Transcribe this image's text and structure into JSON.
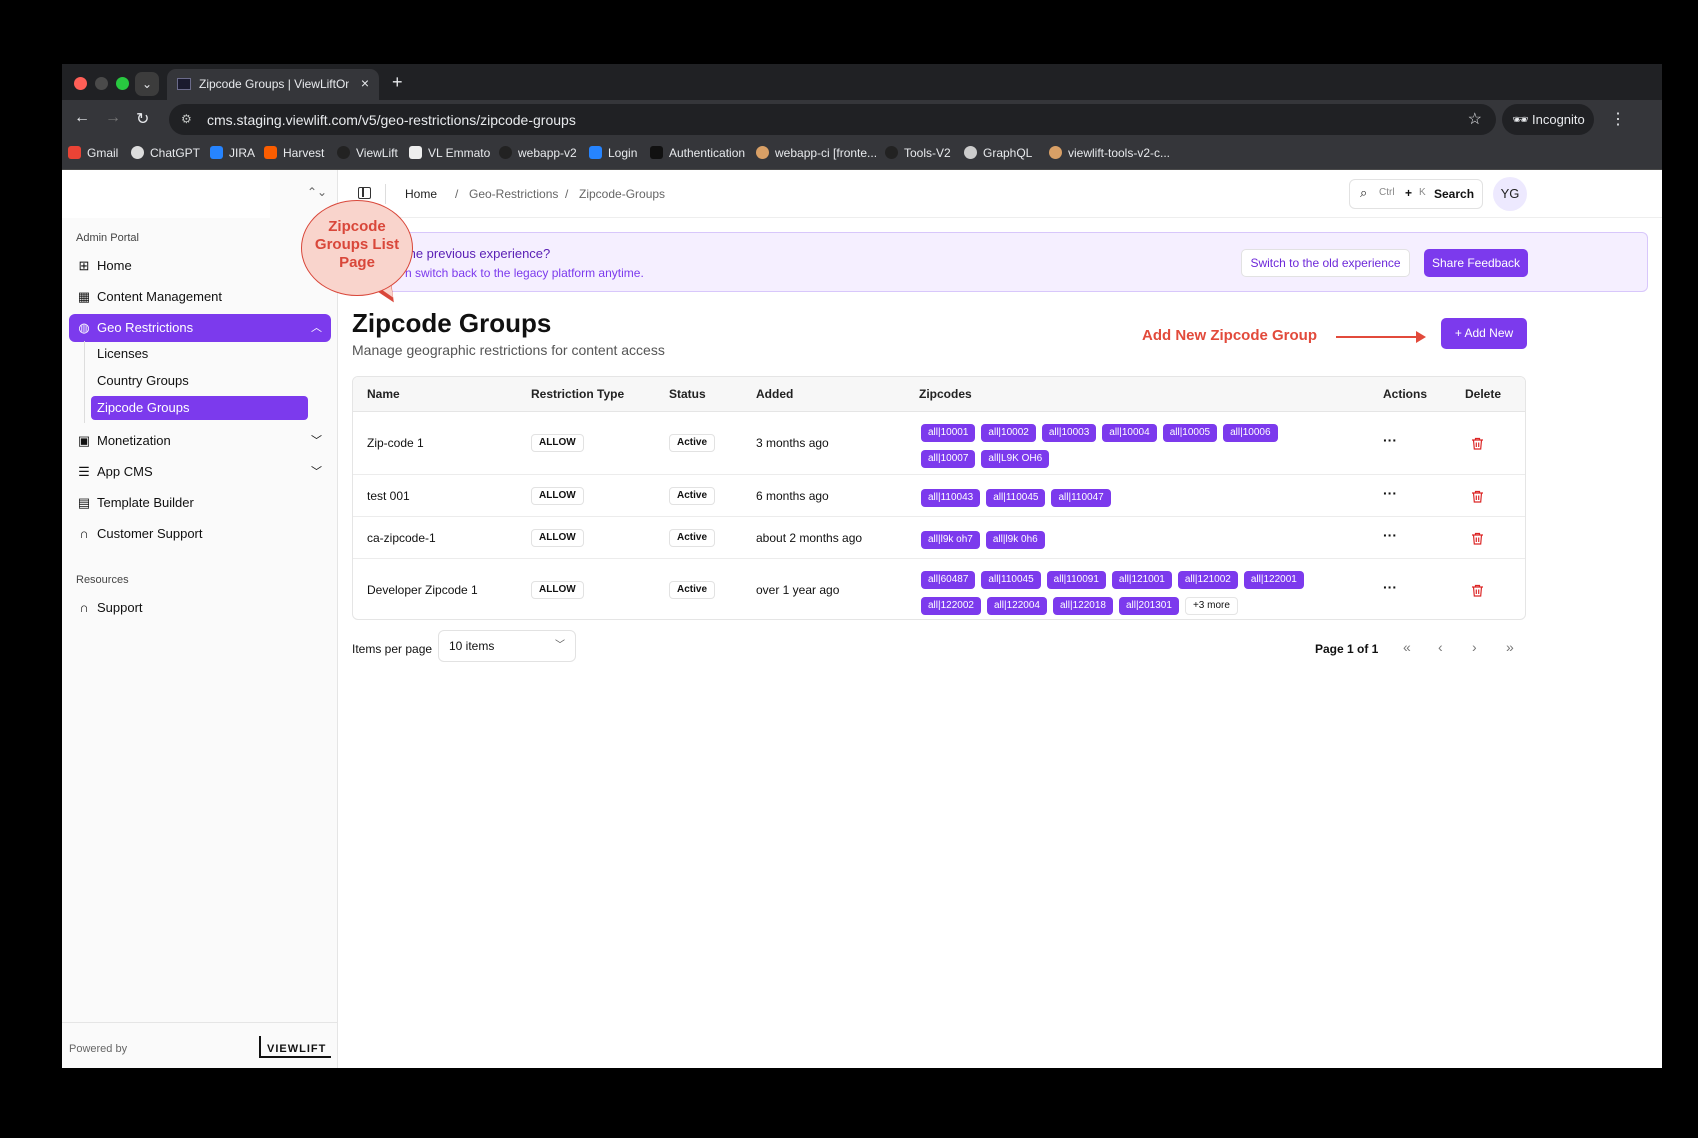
{
  "browser": {
    "tab_title": "Zipcode Groups | ViewLiftOne",
    "url": "cms.staging.viewlift.com/v5/geo-restrictions/zipcode-groups",
    "profile": "Incognito",
    "bookmarks": [
      "Gmail",
      "ChatGPT",
      "JIRA",
      "Harvest",
      "ViewLift",
      "VL Emmato",
      "webapp-v2",
      "Login",
      "Authentication",
      "webapp-ci [fronte...",
      "Tools-V2",
      "GraphQL",
      "viewlift-tools-v2-c..."
    ]
  },
  "sidebar": {
    "section_admin": "Admin Portal",
    "items": [
      {
        "label": "Home",
        "icon": "grid-icon"
      },
      {
        "label": "Content Management",
        "icon": "film-icon"
      },
      {
        "label": "Geo Restrictions",
        "icon": "globe-icon",
        "active": true
      },
      {
        "label": "Monetization",
        "icon": "wallet-icon"
      },
      {
        "label": "App CMS",
        "icon": "sliders-icon"
      },
      {
        "label": "Template Builder",
        "icon": "layout-icon"
      },
      {
        "label": "Customer Support",
        "icon": "headset-icon"
      }
    ],
    "subitems": [
      "Licenses",
      "Country Groups",
      "Zipcode Groups"
    ],
    "section_resources": "Resources",
    "support": "Support",
    "powered_by": "Powered by",
    "logo_text": "VIEWLIFT"
  },
  "topbar": {
    "breadcrumb": [
      "Home",
      "Geo-Restrictions",
      "Zipcode-Groups"
    ],
    "search_kbd_1": "Ctrl",
    "search_plus": "+",
    "search_kbd_2": "K",
    "search_label": "Search",
    "avatar": "YG"
  },
  "banner": {
    "title": "the previous experience?",
    "subtitle": "n switch back to the legacy platform anytime.",
    "switch_button": "Switch to the old experience",
    "feedback_button": "Share Feedback"
  },
  "annotations": {
    "callout": "Zipcode Groups List Page",
    "add_new_label": "Add New Zipcode Group"
  },
  "page": {
    "title": "Zipcode Groups",
    "subtitle": "Manage geographic restrictions for content access",
    "add_button": "+ Add New"
  },
  "table": {
    "headers": [
      "Name",
      "Restriction Type",
      "Status",
      "Added",
      "Zipcodes",
      "Actions",
      "Delete"
    ],
    "rows": [
      {
        "name": "Zip-code 1",
        "type": "ALLOW",
        "status": "Active",
        "added": "3 months ago",
        "zipcodes": [
          "all|10001",
          "all|10002",
          "all|10003",
          "all|10004",
          "all|10005",
          "all|10006",
          "all|10007",
          "all|L9K OH6"
        ]
      },
      {
        "name": "test 001",
        "type": "ALLOW",
        "status": "Active",
        "added": "6 months ago",
        "zipcodes": [
          "all|110043",
          "all|110045",
          "all|110047"
        ]
      },
      {
        "name": "ca-zipcode-1",
        "type": "ALLOW",
        "status": "Active",
        "added": "about 2 months ago",
        "zipcodes": [
          "all|l9k oh7",
          "all|l9k 0h6"
        ]
      },
      {
        "name": "Developer Zipcode 1",
        "type": "ALLOW",
        "status": "Active",
        "added": "over 1 year ago",
        "zipcodes": [
          "all|60487",
          "all|110045",
          "all|110091",
          "all|121001",
          "all|121002",
          "all|122001",
          "all|122002",
          "all|122004",
          "all|122018",
          "all|201301"
        ],
        "more": "+3 more"
      }
    ]
  },
  "pagination": {
    "items_per_page_label": "Items per page",
    "items_per_page_value": "10 items",
    "page_info": "Page 1 of 1"
  },
  "colors": {
    "accent": "#7c3aed",
    "annotation": "#e24a3b"
  }
}
